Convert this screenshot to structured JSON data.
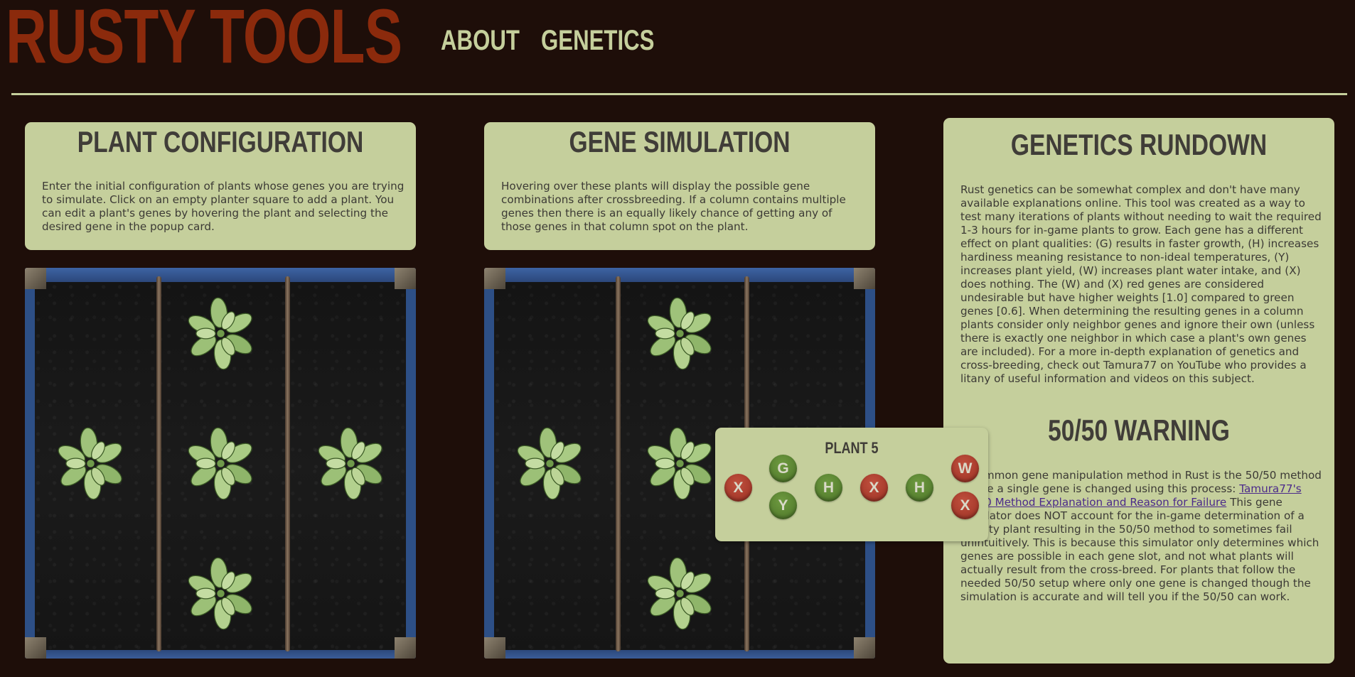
{
  "header": {
    "logo": "RUSTY TOOLS",
    "nav": [
      {
        "label": "ABOUT"
      },
      {
        "label": "GENETICS"
      }
    ]
  },
  "plant_config": {
    "title": "PLANT CONFIGURATION",
    "description": "Enter the initial configuration of plants whose genes you are trying to simulate. Click on an empty planter square to add a plant. You can edit a plant's genes by hovering the plant and selecting the desired gene in the popup card."
  },
  "gene_sim": {
    "title": "GENE SIMULATION",
    "description": "Hovering over these plants will display the possible gene combinations after crossbreeding. If a column contains multiple genes then there is an equally likely chance of getting any of those genes in that column spot on the plant."
  },
  "rundown": {
    "title": "GENETICS RUNDOWN",
    "body": "Rust genetics can be somewhat complex and don't have many available explanations online. This tool was created as a way to test many iterations of plants without needing to wait the required 1-3 hours for in-game plants to grow. Each gene has a different effect on plant qualities: (G) results in faster growth, (H) increases hardiness meaning resistance to non-ideal temperatures, (Y) increases plant yield, (W) increases plant water intake, and (X) does nothing. The (W) and (X) red genes are considered undesirable but have higher weights [1.0] compared to green genes [0.6]. When determining the resulting genes in a column plants consider only neighbor genes and ignore their own (unless there is exactly one neighbor in which case a plant's own genes are included). For a more in-depth explanation of genetics and cross-breeding, check out Tamura77 on YouTube who provides a litany of useful information and videos on this subject.",
    "warning_title": "50/50 WARNING",
    "warning_intro": "A common gene manipulation method in Rust is the 50/50 method where a single gene is changed using this process:",
    "warning_link": "Tamura77's 50/50 Method Explanation and Reason for Failure",
    "warning_body": "This gene simulator does NOT account for the in-game determination of a priority plant resulting in the 50/50 method to sometimes fail unintuitively. This is because this simulator only determines which genes are possible in each gene slot, and not what plants will actually result from the cross-breed. For plants that follow the needed 50/50 setup where only one gene is changed though the simulation is accurate and will tell you if the 50/50 can work."
  },
  "planter_grid": {
    "rows": 3,
    "cols": 3,
    "plants": [
      {
        "row": 0,
        "col": 1
      },
      {
        "row": 1,
        "col": 0
      },
      {
        "row": 1,
        "col": 1
      },
      {
        "row": 1,
        "col": 2
      },
      {
        "row": 2,
        "col": 1
      }
    ]
  },
  "popup": {
    "title": "PLANT 5",
    "columns": [
      [
        "X"
      ],
      [
        "G",
        "Y"
      ],
      [
        "H"
      ],
      [
        "X"
      ],
      [
        "H"
      ],
      [
        "W",
        "X"
      ]
    ],
    "gene_colors": {
      "G": "#5c8834",
      "H": "#5c8834",
      "Y": "#5c8834",
      "W": "#ad3f2f",
      "X": "#ad3f2f"
    }
  }
}
